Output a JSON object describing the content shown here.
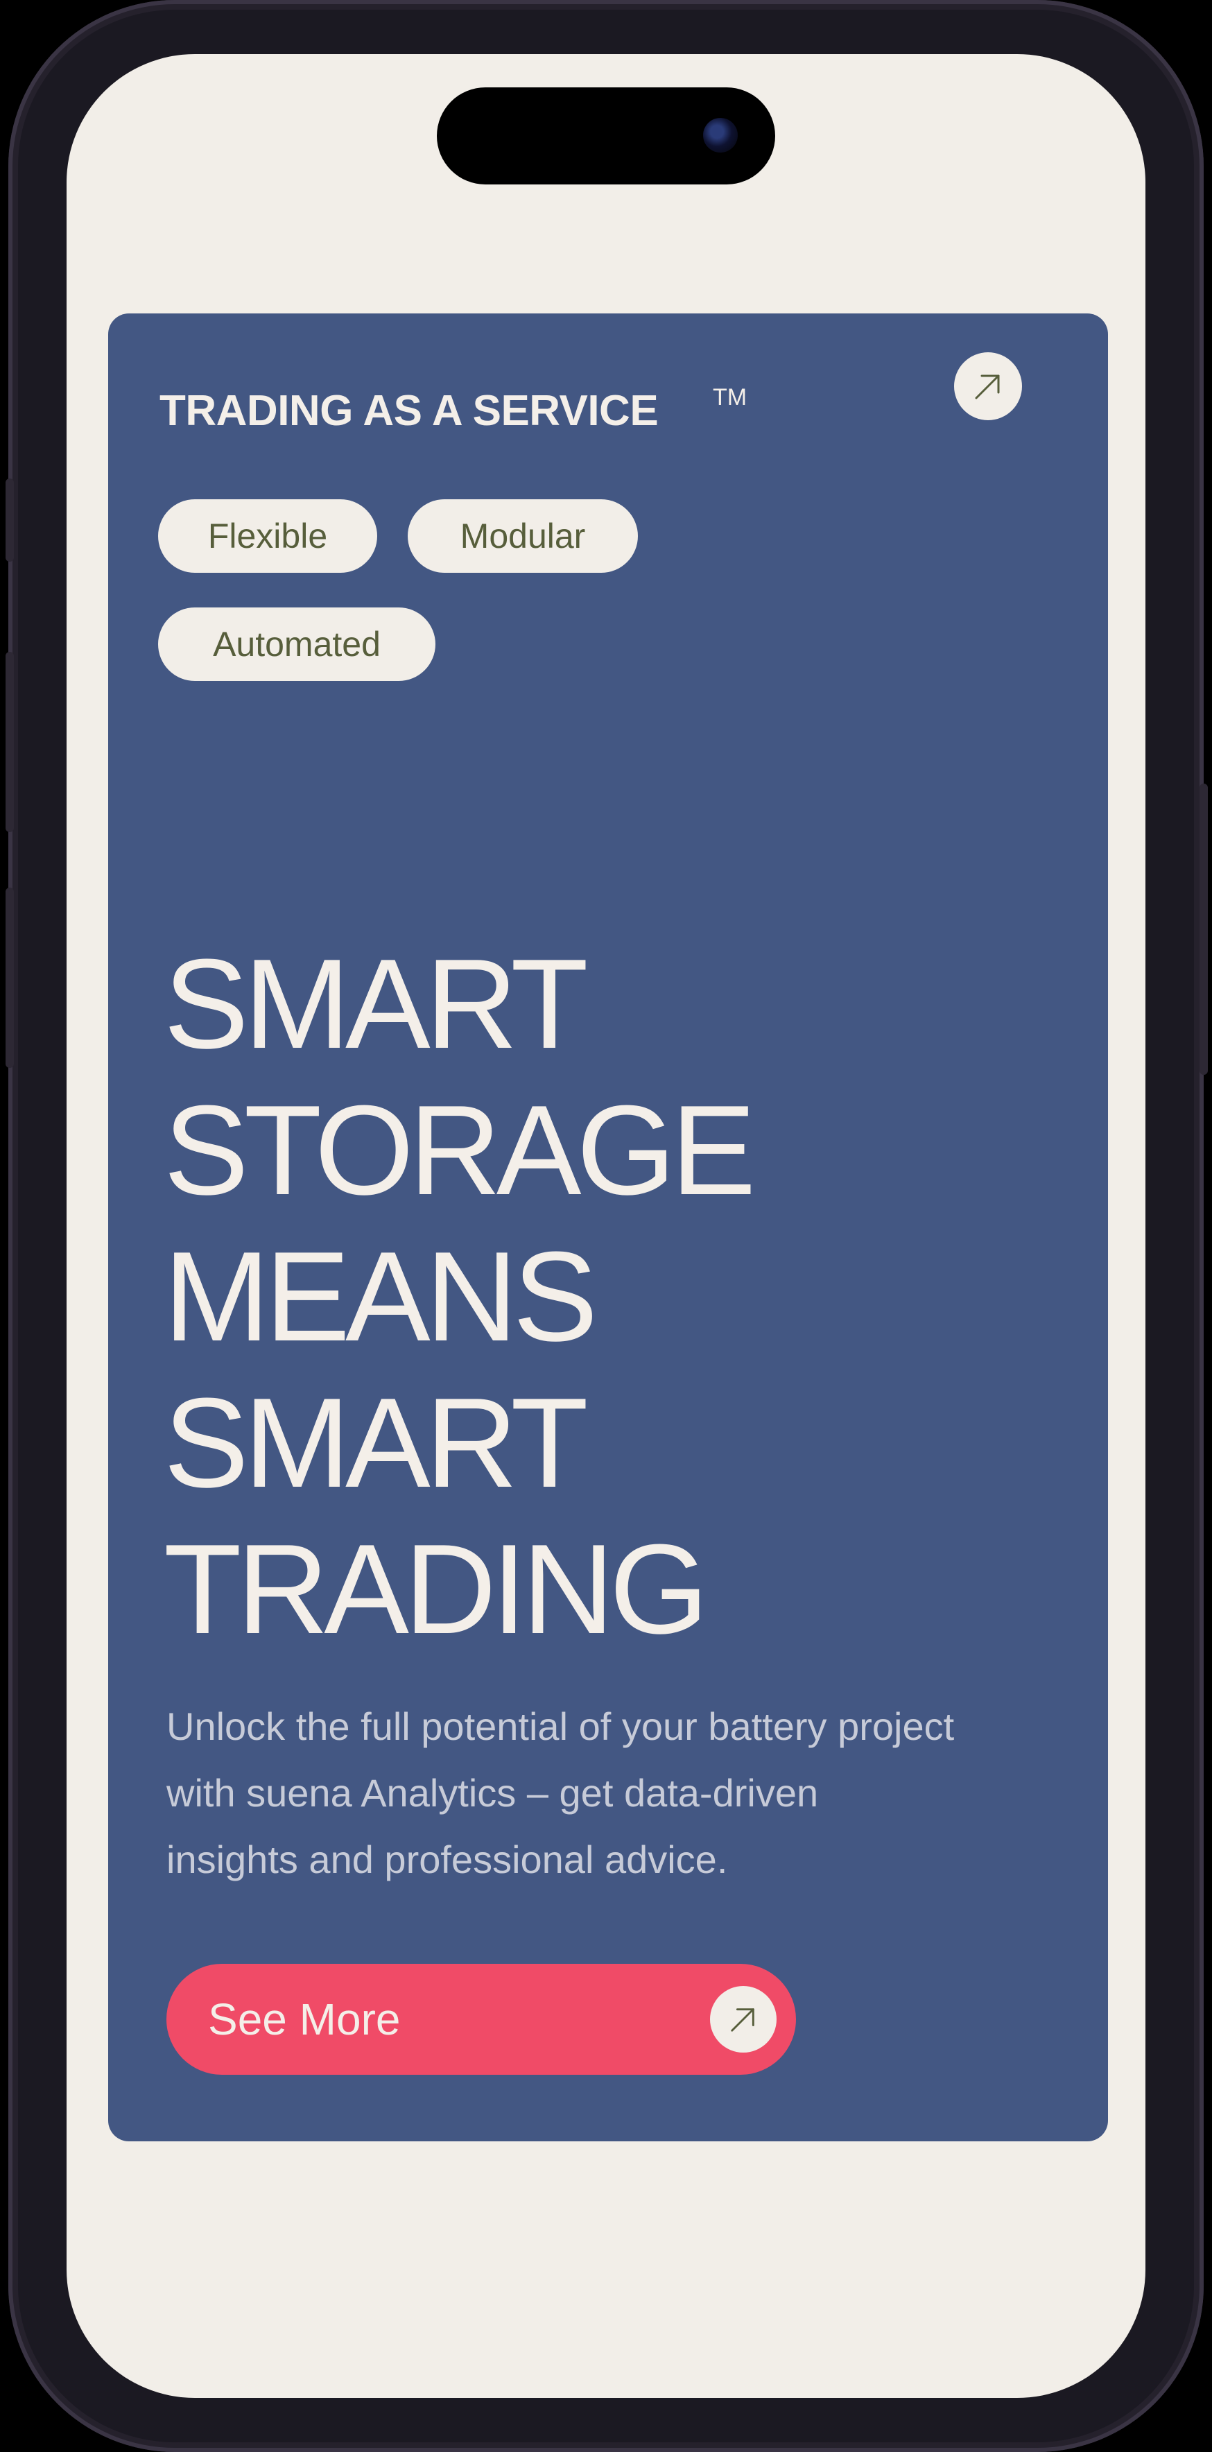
{
  "card": {
    "brand": "TRADING AS A SERVICE",
    "trademark": "TM",
    "tags": [
      "Flexible",
      "Modular",
      "Automated"
    ],
    "headline": [
      "SMART",
      "STORAGE",
      "MEANS",
      "SMART",
      "TRADING"
    ],
    "description": "Unlock the full potential of your battery project with suena Analytics – get data-driven insights and professional advice.",
    "cta_label": "See More"
  },
  "icons": {
    "corner_link": "arrow-up-right-icon",
    "cta": "arrow-up-right-icon"
  },
  "colors": {
    "screen_background": "#f2eee8",
    "card_background": "#435783",
    "cta_background": "#f04b67",
    "tag_text": "#575e3b",
    "light_text": "#f4efe9"
  }
}
